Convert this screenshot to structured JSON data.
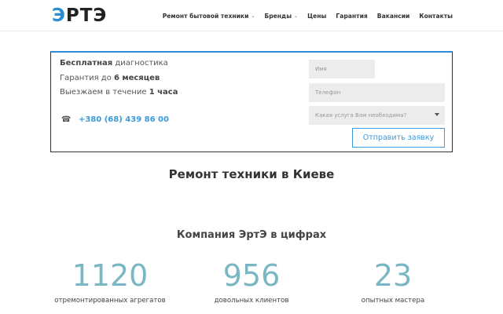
{
  "header": {
    "logo": {
      "part1": "Э",
      "part2": "РТЭ"
    },
    "nav": [
      {
        "label": "Ремонт бытовой техники",
        "has_dropdown": true
      },
      {
        "label": "Бренды",
        "has_dropdown": true
      },
      {
        "label": "Цены",
        "has_dropdown": false
      },
      {
        "label": "Гарантия",
        "has_dropdown": false
      },
      {
        "label": "Вакансии",
        "has_dropdown": false
      },
      {
        "label": "Контакты",
        "has_dropdown": false
      }
    ]
  },
  "promo": {
    "line1_bold": "Бесплатная",
    "line1_rest": " диагностика",
    "line2_pre": "Гарантия до ",
    "line2_bold": "6 месяцев",
    "line3_pre": "Выезжаем в течение ",
    "line3_bold": "1 часа",
    "phone_icon": "☎",
    "phone": "+380 (68) 439 86 00"
  },
  "form": {
    "name_placeholder": "Имя",
    "phone_placeholder": "Телефон",
    "service_placeholder": "Какая услуга Вам необходима?",
    "submit_label": "Отправить заявку"
  },
  "main": {
    "title": "Ремонт техники в Киеве",
    "stats_title": "Компания ЭртЭ в цифрах",
    "stats": [
      {
        "value": "1120",
        "caption": "отремонтированных агрегатов"
      },
      {
        "value": "956",
        "caption": "довольных клиентов"
      },
      {
        "value": "23",
        "caption": "опытных мастера"
      }
    ]
  },
  "colors": {
    "accent": "#2a8dd4",
    "link": "#3a9ad9",
    "stat": "#7ab7c4"
  },
  "icons": {
    "phone": "phone-icon",
    "dropdown": "chevron-down-icon"
  }
}
